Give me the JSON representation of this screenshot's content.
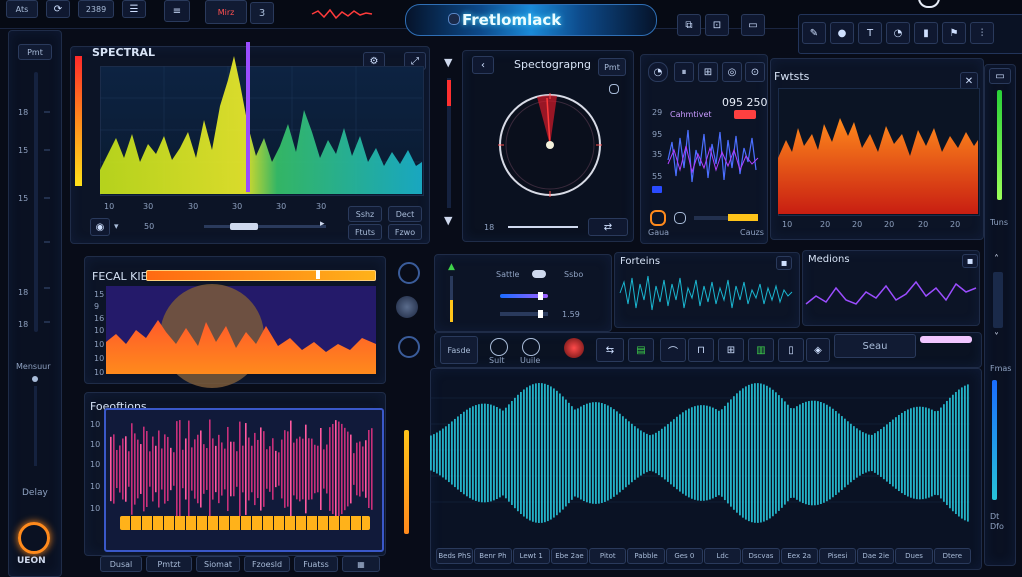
{
  "topbar": {
    "left_items": [
      "Ats",
      "2389",
      "Mirz",
      "3"
    ],
    "app_title": "Fretlomlack",
    "right_icons": [
      "pen-icon",
      "dot-icon",
      "t-icon",
      "gauge-icon",
      "bars-icon",
      "flag-icon",
      "sliders-icon"
    ]
  },
  "left_sidebar": {
    "header": "Pmt",
    "scale": [
      "18",
      "15",
      "15",
      "18",
      "18"
    ],
    "mode_label": "Mensuur",
    "bottom_label": "Delay",
    "logo_text": "UEON"
  },
  "spectral": {
    "title": "SPECTRAL",
    "x_ticks": [
      "10",
      "30",
      "30",
      "30",
      "30",
      "30"
    ],
    "value": "50",
    "btn1": "Sshz",
    "btn2": "Dect",
    "btn3": "Ftuts",
    "btn4": "Fzwo"
  },
  "spectrograph": {
    "title": "Spectograpng",
    "btn": "Pmt",
    "value": "18"
  },
  "meter": {
    "readout": "095 250",
    "sub_label": "Cahmtivet",
    "scale": [
      "29",
      "95",
      "35",
      "55"
    ],
    "footer_left": "Gaua",
    "footer_right": "Cauzs"
  },
  "phaser": {
    "title": "Fwtsts",
    "x_ticks": [
      "10",
      "20",
      "20",
      "20",
      "20",
      "20"
    ],
    "side_label": "Tuns"
  },
  "feedback": {
    "title": "FECAL KIEY",
    "scale": [
      "15",
      "9",
      "16",
      "10",
      "10",
      "10",
      "10"
    ]
  },
  "controls": {
    "label1": "Sattle",
    "label2": "Ssbo",
    "value": "1.59"
  },
  "forts": {
    "title": "Forteins"
  },
  "medions": {
    "title": "Medions"
  },
  "effects": {
    "btns": [
      "Fasde",
      "Sult",
      "Uuile"
    ],
    "send_label": "Seau"
  },
  "frequencies": {
    "title": "Foeoftions",
    "scale": [
      "10",
      "10",
      "10",
      "10",
      "10"
    ],
    "footer_btns": [
      "Dusal",
      "Pmtzt",
      "Siomat",
      "Fzoesld",
      "Fuatss"
    ]
  },
  "waveform": {
    "bottom_labels": [
      "Beds PhS",
      "Benr Ph",
      "Lewt 1",
      "Ebe 2ae",
      "Pitot",
      "Pabble",
      "Ges 0",
      "Ldc",
      "Dscvas",
      "Eex 2a",
      "Pisesi",
      "Dae 2ie",
      "Dues",
      "Dtere"
    ]
  },
  "right_sidebar": {
    "labels": [
      "Fmas",
      "Tuns",
      "Dt",
      "Dfo"
    ]
  },
  "colors": {
    "bg": "#080c18",
    "accent": "#27c3d8",
    "orange": "#ff7a1a",
    "magenta": "#d2306f",
    "purple": "#9b4dff",
    "green": "#3fd34a"
  }
}
